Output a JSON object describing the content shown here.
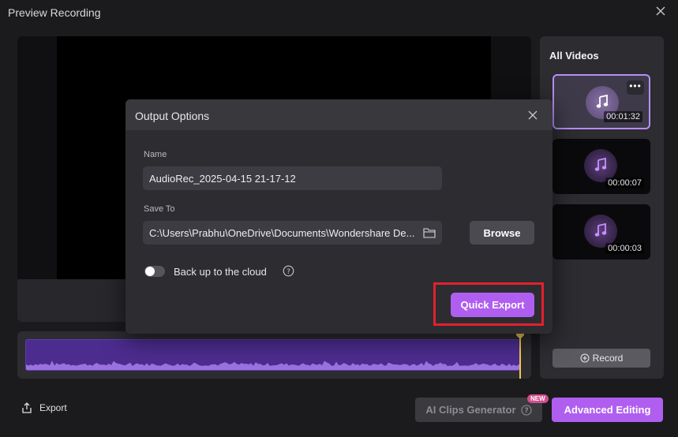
{
  "window": {
    "title": "Preview Recording",
    "close_icon": "close-icon"
  },
  "dialog": {
    "title": "Output Options",
    "name_label": "Name",
    "name_value": "AudioRec_2025-04-15 21-17-12",
    "save_to_label": "Save To",
    "save_to_value": "C:\\Users\\Prabhu\\OneDrive\\Documents\\Wondershare De...",
    "browse_label": "Browse",
    "backup_label": "Back up to the cloud",
    "backup_enabled": false,
    "quick_export_label": "Quick Export"
  },
  "sidebar": {
    "title": "All Videos",
    "videos": [
      {
        "duration": "00:01:32",
        "selected": true
      },
      {
        "duration": "00:00:07",
        "selected": false
      },
      {
        "duration": "00:00:03",
        "selected": false
      }
    ],
    "record_label": "Record"
  },
  "footer": {
    "export_label": "Export",
    "ai_clips_label": "AI Clips Generator",
    "new_badge": "NEW",
    "advanced_editing_label": "Advanced Editing"
  },
  "colors": {
    "accent": "#b05ef0",
    "highlight": "#e3202e",
    "waveform": "#4c2c8e",
    "playhead": "#f2c94c"
  }
}
